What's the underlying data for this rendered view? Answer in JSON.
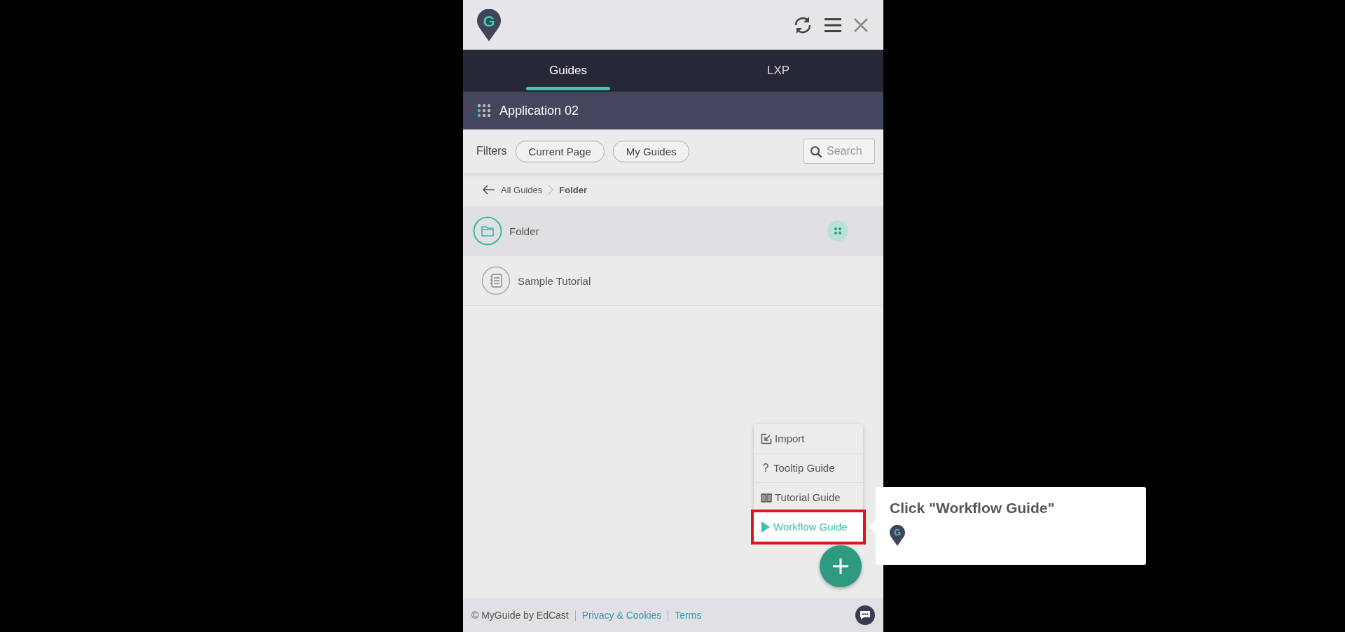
{
  "header": {
    "logo_letter": "G"
  },
  "tabs": [
    {
      "label": "Guides",
      "selected": true
    },
    {
      "label": "LXP",
      "selected": false
    }
  ],
  "application": {
    "name": "Application 02"
  },
  "filters": {
    "label": "Filters",
    "chips": [
      "Current Page",
      "My Guides"
    ],
    "search": {
      "placeholder": "Search"
    }
  },
  "breadcrumb": {
    "items": [
      "All Guides",
      "Folder"
    ]
  },
  "items": [
    {
      "kind": "folder",
      "title": "Folder",
      "selected": true
    },
    {
      "kind": "tutorial",
      "title": "Sample Tutorial",
      "selected": false
    }
  ],
  "create_menu": {
    "items": [
      {
        "kind": "import",
        "label": "Import",
        "highlighted": false
      },
      {
        "kind": "tooltip",
        "glyph": "?",
        "label": "Tooltip Guide",
        "highlighted": false
      },
      {
        "kind": "tutorial",
        "label": "Tutorial Guide",
        "highlighted": false
      },
      {
        "kind": "workflow",
        "label": "Workflow Guide",
        "highlighted": true
      }
    ]
  },
  "tooltip": {
    "title": "Click \"Workflow Guide\"",
    "logo_letter": "G"
  },
  "footer": {
    "copyright": "© MyGuide by EdCast",
    "links": [
      "Privacy & Cookies",
      "Terms"
    ]
  }
}
